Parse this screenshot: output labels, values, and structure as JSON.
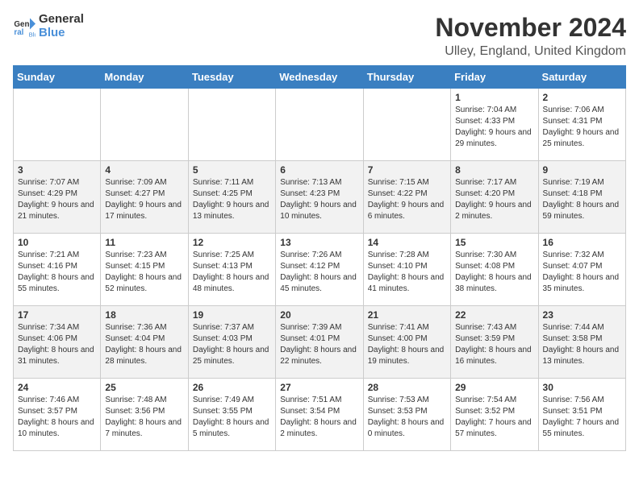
{
  "header": {
    "logo_line1": "General",
    "logo_line2": "Blue",
    "month": "November 2024",
    "location": "Ulley, England, United Kingdom"
  },
  "weekdays": [
    "Sunday",
    "Monday",
    "Tuesday",
    "Wednesday",
    "Thursday",
    "Friday",
    "Saturday"
  ],
  "weeks": [
    [
      {
        "day": "",
        "info": ""
      },
      {
        "day": "",
        "info": ""
      },
      {
        "day": "",
        "info": ""
      },
      {
        "day": "",
        "info": ""
      },
      {
        "day": "",
        "info": ""
      },
      {
        "day": "1",
        "info": "Sunrise: 7:04 AM\nSunset: 4:33 PM\nDaylight: 9 hours and 29 minutes."
      },
      {
        "day": "2",
        "info": "Sunrise: 7:06 AM\nSunset: 4:31 PM\nDaylight: 9 hours and 25 minutes."
      }
    ],
    [
      {
        "day": "3",
        "info": "Sunrise: 7:07 AM\nSunset: 4:29 PM\nDaylight: 9 hours and 21 minutes."
      },
      {
        "day": "4",
        "info": "Sunrise: 7:09 AM\nSunset: 4:27 PM\nDaylight: 9 hours and 17 minutes."
      },
      {
        "day": "5",
        "info": "Sunrise: 7:11 AM\nSunset: 4:25 PM\nDaylight: 9 hours and 13 minutes."
      },
      {
        "day": "6",
        "info": "Sunrise: 7:13 AM\nSunset: 4:23 PM\nDaylight: 9 hours and 10 minutes."
      },
      {
        "day": "7",
        "info": "Sunrise: 7:15 AM\nSunset: 4:22 PM\nDaylight: 9 hours and 6 minutes."
      },
      {
        "day": "8",
        "info": "Sunrise: 7:17 AM\nSunset: 4:20 PM\nDaylight: 9 hours and 2 minutes."
      },
      {
        "day": "9",
        "info": "Sunrise: 7:19 AM\nSunset: 4:18 PM\nDaylight: 8 hours and 59 minutes."
      }
    ],
    [
      {
        "day": "10",
        "info": "Sunrise: 7:21 AM\nSunset: 4:16 PM\nDaylight: 8 hours and 55 minutes."
      },
      {
        "day": "11",
        "info": "Sunrise: 7:23 AM\nSunset: 4:15 PM\nDaylight: 8 hours and 52 minutes."
      },
      {
        "day": "12",
        "info": "Sunrise: 7:25 AM\nSunset: 4:13 PM\nDaylight: 8 hours and 48 minutes."
      },
      {
        "day": "13",
        "info": "Sunrise: 7:26 AM\nSunset: 4:12 PM\nDaylight: 8 hours and 45 minutes."
      },
      {
        "day": "14",
        "info": "Sunrise: 7:28 AM\nSunset: 4:10 PM\nDaylight: 8 hours and 41 minutes."
      },
      {
        "day": "15",
        "info": "Sunrise: 7:30 AM\nSunset: 4:08 PM\nDaylight: 8 hours and 38 minutes."
      },
      {
        "day": "16",
        "info": "Sunrise: 7:32 AM\nSunset: 4:07 PM\nDaylight: 8 hours and 35 minutes."
      }
    ],
    [
      {
        "day": "17",
        "info": "Sunrise: 7:34 AM\nSunset: 4:06 PM\nDaylight: 8 hours and 31 minutes."
      },
      {
        "day": "18",
        "info": "Sunrise: 7:36 AM\nSunset: 4:04 PM\nDaylight: 8 hours and 28 minutes."
      },
      {
        "day": "19",
        "info": "Sunrise: 7:37 AM\nSunset: 4:03 PM\nDaylight: 8 hours and 25 minutes."
      },
      {
        "day": "20",
        "info": "Sunrise: 7:39 AM\nSunset: 4:01 PM\nDaylight: 8 hours and 22 minutes."
      },
      {
        "day": "21",
        "info": "Sunrise: 7:41 AM\nSunset: 4:00 PM\nDaylight: 8 hours and 19 minutes."
      },
      {
        "day": "22",
        "info": "Sunrise: 7:43 AM\nSunset: 3:59 PM\nDaylight: 8 hours and 16 minutes."
      },
      {
        "day": "23",
        "info": "Sunrise: 7:44 AM\nSunset: 3:58 PM\nDaylight: 8 hours and 13 minutes."
      }
    ],
    [
      {
        "day": "24",
        "info": "Sunrise: 7:46 AM\nSunset: 3:57 PM\nDaylight: 8 hours and 10 minutes."
      },
      {
        "day": "25",
        "info": "Sunrise: 7:48 AM\nSunset: 3:56 PM\nDaylight: 8 hours and 7 minutes."
      },
      {
        "day": "26",
        "info": "Sunrise: 7:49 AM\nSunset: 3:55 PM\nDaylight: 8 hours and 5 minutes."
      },
      {
        "day": "27",
        "info": "Sunrise: 7:51 AM\nSunset: 3:54 PM\nDaylight: 8 hours and 2 minutes."
      },
      {
        "day": "28",
        "info": "Sunrise: 7:53 AM\nSunset: 3:53 PM\nDaylight: 8 hours and 0 minutes."
      },
      {
        "day": "29",
        "info": "Sunrise: 7:54 AM\nSunset: 3:52 PM\nDaylight: 7 hours and 57 minutes."
      },
      {
        "day": "30",
        "info": "Sunrise: 7:56 AM\nSunset: 3:51 PM\nDaylight: 7 hours and 55 minutes."
      }
    ]
  ]
}
